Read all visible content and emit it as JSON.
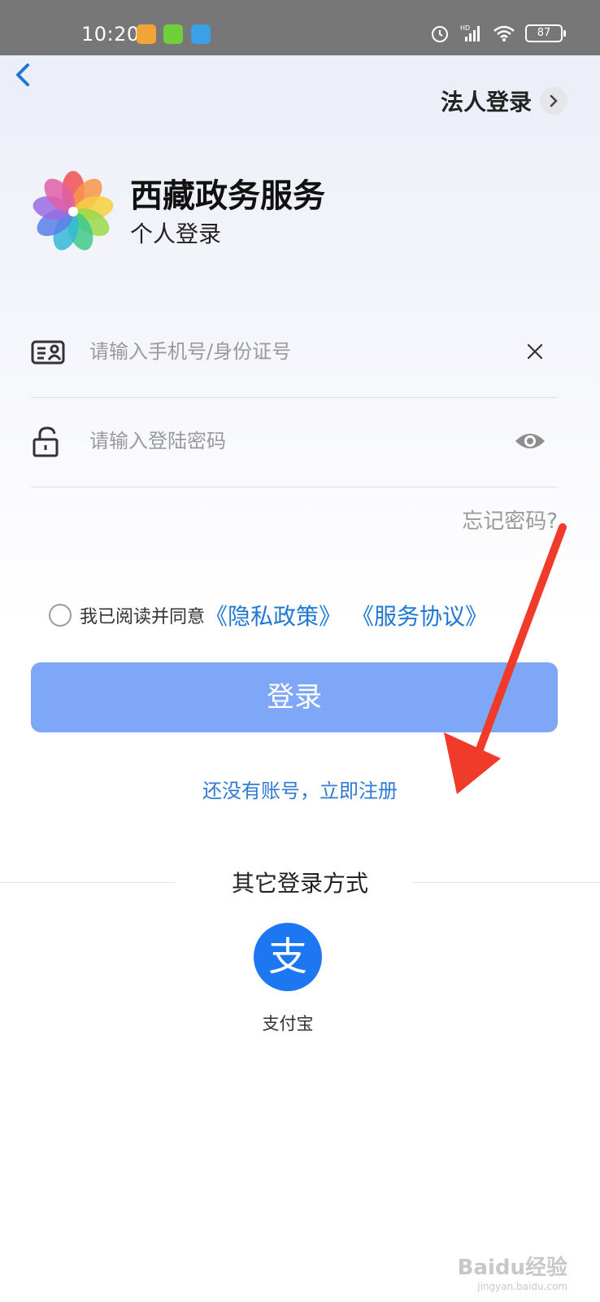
{
  "status_bar": {
    "time": "10:20",
    "battery": "87",
    "icons": [
      "message-app-icon",
      "download-app-icon",
      "telegram-app-icon",
      "alarm-icon",
      "hd-signal-icon",
      "wifi-icon",
      "battery-icon"
    ]
  },
  "header": {
    "back_icon": "chevron-left-icon",
    "corporate_login_label": "法人登录",
    "corporate_login_icon": "chevron-right-icon"
  },
  "brand": {
    "title": "西藏政务服务",
    "subtitle": "个人登录",
    "logo_icon": "flower-logo"
  },
  "form": {
    "account_placeholder": "请输入手机号/身份证号",
    "account_icon": "id-card-icon",
    "clear_icon": "close-icon",
    "password_placeholder": "请输入登陆密码",
    "password_icon": "lock-icon",
    "eye_icon": "eye-icon",
    "forgot_password": "忘记密码?"
  },
  "agreement": {
    "prefix": "我已阅读并同意",
    "privacy": "《隐私政策》",
    "service": "《服务协议》"
  },
  "login_button": "登录",
  "register_link": "还没有账号，立即注册",
  "other_login": {
    "title": "其它登录方式",
    "alipay_glyph": "支",
    "alipay_label": "支付宝"
  },
  "watermark": {
    "text": "Baidu经验",
    "url": "jingyan.baidu.com"
  },
  "colors": {
    "accent_blue": "#2178d4",
    "login_button": "#7ea8f7",
    "alipay_blue": "#1d77f2",
    "annotation_arrow": "#f03a2a"
  }
}
